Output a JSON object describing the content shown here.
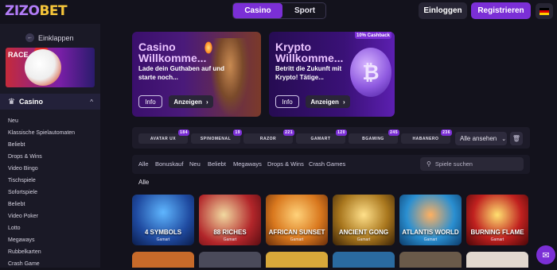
{
  "header": {
    "logo_part1": "ZIZO",
    "logo_part2": "BET",
    "tab_casino": "Casino",
    "tab_sport": "Sport",
    "login": "Einloggen",
    "register": "Registrieren"
  },
  "sidebar": {
    "collapse": "Einklappen",
    "promo_text": "RACE",
    "section_title": "Casino",
    "items": [
      "Neu",
      "Klassische Spielautomaten",
      "Beliebt",
      "Drops & Wins",
      "Video Bingo",
      "Tischspiele",
      "Sofortspiele",
      "Beliebt",
      "Video Poker",
      "Lotto",
      "Megaways",
      "Rubbelkarten",
      "Crash Game"
    ]
  },
  "banners": [
    {
      "title_line1": "Casino",
      "title_line2": "Willkomme...",
      "subtitle": "Lade dein Guthaben auf und starte noch...",
      "info": "Info",
      "show": "Anzeigen"
    },
    {
      "title_line1": "Krypto",
      "title_line2": "Willkomme...",
      "subtitle": "Betritt die Zukunft mit Krypto! Tätige...",
      "info": "Info",
      "show": "Anzeigen",
      "badge": "10% Cashback"
    }
  ],
  "providers": [
    {
      "name": "AVATAR UX",
      "count": "184"
    },
    {
      "name": "SPINOMENAL",
      "count": "19"
    },
    {
      "name": "RAZOR",
      "count": "221"
    },
    {
      "name": "GAMART",
      "count": "120"
    },
    {
      "name": "BGAMING",
      "count": "245"
    },
    {
      "name": "HABANERO",
      "count": "236"
    }
  ],
  "providers_showall": "Alle ansehen",
  "filters": [
    "Alle",
    "Bonuskauf",
    "Neu",
    "Beliebt",
    "Megaways",
    "Drops & Wins",
    "Crash Games"
  ],
  "search_placeholder": "Spiele suchen",
  "section_label": "Alle",
  "games": [
    {
      "name": "4 SYMBOLS",
      "provider": "Gamart",
      "color": "#1f4aa0"
    },
    {
      "name": "88 RICHES",
      "provider": "Gamart",
      "color": "#b2262a"
    },
    {
      "name": "AFRICAN SUNSET",
      "provider": "Gamart",
      "color": "#d9781e"
    },
    {
      "name": "ANCIENT GONG",
      "provider": "Gamart",
      "color": "#a9771e"
    },
    {
      "name": "ATLANTIS WORLD",
      "provider": "Gamart",
      "color": "#2a8fd1"
    },
    {
      "name": "BURNING FLAME",
      "provider": "Gamart",
      "color": "#c0211f"
    }
  ],
  "colors": {
    "accent": "#7b2fd6",
    "bg": "#13121c",
    "panel": "#1a1926"
  }
}
